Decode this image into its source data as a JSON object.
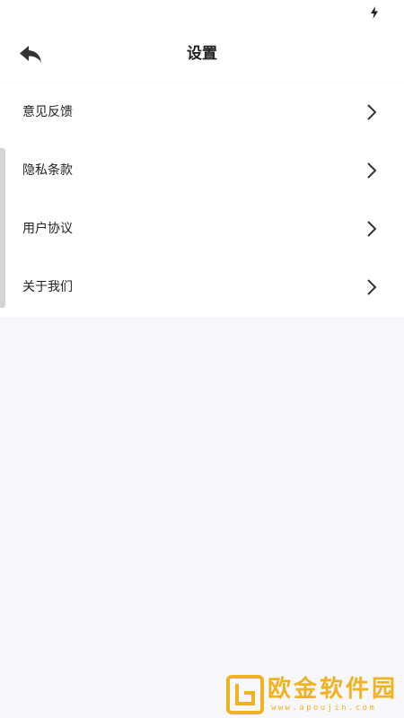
{
  "status_bar": {
    "icon": "battery-charging-icon"
  },
  "header": {
    "title": "设置",
    "back_icon": "back-arrow-icon"
  },
  "settings": {
    "items": [
      {
        "label": "意见反馈",
        "icon": "chevron-right-icon"
      },
      {
        "label": "隐私条款",
        "icon": "chevron-right-icon"
      },
      {
        "label": "用户协议",
        "icon": "chevron-right-icon"
      },
      {
        "label": "关于我们",
        "icon": "chevron-right-icon"
      }
    ]
  },
  "watermark": {
    "brand": "欧金软件园",
    "url": "www.apoujin.com"
  },
  "colors": {
    "background": "#f8f8fc",
    "surface": "#ffffff",
    "text": "#222222",
    "watermark": "#f0b21f"
  }
}
